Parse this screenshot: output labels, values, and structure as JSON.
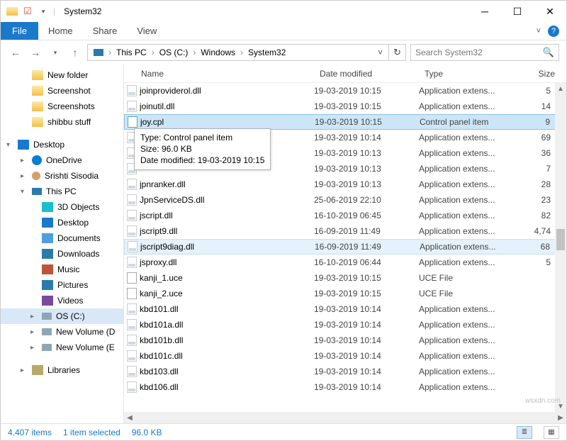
{
  "titlebar": {
    "title": "System32"
  },
  "ribbon": {
    "file": "File",
    "tabs": [
      "Home",
      "Share",
      "View"
    ]
  },
  "nav": {
    "crumbs": [
      "This PC",
      "OS (C:)",
      "Windows",
      "System32"
    ],
    "search_placeholder": "Search System32"
  },
  "tree": {
    "quick": [
      {
        "label": "New folder",
        "ico": "t-folder"
      },
      {
        "label": "Screenshot",
        "ico": "t-folder"
      },
      {
        "label": "Screenshots",
        "ico": "t-folder"
      },
      {
        "label": "shibbu stuff",
        "ico": "t-folder"
      }
    ],
    "roots": [
      {
        "label": "Desktop",
        "ico": "t-desktop",
        "chev": "▾",
        "depth": 0
      },
      {
        "label": "OneDrive",
        "ico": "t-onedrive",
        "chev": "▸",
        "depth": 1
      },
      {
        "label": "Srishti Sisodia",
        "ico": "t-user",
        "chev": "▸",
        "depth": 1
      },
      {
        "label": "This PC",
        "ico": "t-pc",
        "chev": "▾",
        "depth": 1
      },
      {
        "label": "3D Objects",
        "ico": "t-3d",
        "chev": "",
        "depth": 2
      },
      {
        "label": "Desktop",
        "ico": "t-desktop",
        "chev": "",
        "depth": 2
      },
      {
        "label": "Documents",
        "ico": "t-doc",
        "chev": "",
        "depth": 2
      },
      {
        "label": "Downloads",
        "ico": "t-dl",
        "chev": "",
        "depth": 2
      },
      {
        "label": "Music",
        "ico": "t-music",
        "chev": "",
        "depth": 2
      },
      {
        "label": "Pictures",
        "ico": "t-pic",
        "chev": "",
        "depth": 2
      },
      {
        "label": "Videos",
        "ico": "t-vid",
        "chev": "",
        "depth": 2
      },
      {
        "label": "OS (C:)",
        "ico": "t-disk",
        "chev": "▸",
        "depth": 2,
        "sel": true
      },
      {
        "label": "New Volume (D",
        "ico": "t-disk",
        "chev": "▸",
        "depth": 2
      },
      {
        "label": "New Volume (E",
        "ico": "t-disk",
        "chev": "▸",
        "depth": 2
      }
    ],
    "libraries": {
      "label": "Libraries",
      "ico": "t-lib",
      "chev": "▸"
    }
  },
  "columns": {
    "name": "Name",
    "date": "Date modified",
    "type": "Type",
    "size": "Size"
  },
  "files": [
    {
      "name": "joinproviderol.dll",
      "date": "19-03-2019 10:15",
      "type": "Application extens...",
      "size": "5",
      "ico": "dll"
    },
    {
      "name": "joinutil.dll",
      "date": "19-03-2019 10:15",
      "type": "Application extens...",
      "size": "14",
      "ico": "dll"
    },
    {
      "name": "joy.cpl",
      "date": "19-03-2019 10:15",
      "type": "Control panel item",
      "size": "9",
      "ico": "cpl",
      "sel": true
    },
    {
      "name": "",
      "date": "19-03-2019 10:14",
      "type": "Application extens...",
      "size": "69",
      "ico": "dll"
    },
    {
      "name": "",
      "date": "19-03-2019 10:13",
      "type": "Application extens...",
      "size": "36",
      "ico": "dll"
    },
    {
      "name": "",
      "date": "19-03-2019 10:13",
      "type": "Application extens...",
      "size": "7",
      "ico": "dll"
    },
    {
      "name": "jpnranker.dll",
      "date": "19-03-2019 10:13",
      "type": "Application extens...",
      "size": "28",
      "ico": "dll"
    },
    {
      "name": "JpnServiceDS.dll",
      "date": "25-06-2019 22:10",
      "type": "Application extens...",
      "size": "23",
      "ico": "dll"
    },
    {
      "name": "jscript.dll",
      "date": "16-10-2019 06:45",
      "type": "Application extens...",
      "size": "82",
      "ico": "dll"
    },
    {
      "name": "jscript9.dll",
      "date": "16-09-2019 11:49",
      "type": "Application extens...",
      "size": "4,74",
      "ico": "dll"
    },
    {
      "name": "jscript9diag.dll",
      "date": "16-09-2019 11:49",
      "type": "Application extens...",
      "size": "68",
      "ico": "dll",
      "hov": true
    },
    {
      "name": "jsproxy.dll",
      "date": "16-10-2019 06:44",
      "type": "Application extens...",
      "size": "5",
      "ico": "dll"
    },
    {
      "name": "kanji_1.uce",
      "date": "19-03-2019 10:15",
      "type": "UCE File",
      "size": "",
      "ico": "uce"
    },
    {
      "name": "kanji_2.uce",
      "date": "19-03-2019 10:15",
      "type": "UCE File",
      "size": "",
      "ico": "uce"
    },
    {
      "name": "kbd101.dll",
      "date": "19-03-2019 10:14",
      "type": "Application extens...",
      "size": "",
      "ico": "dll"
    },
    {
      "name": "kbd101a.dll",
      "date": "19-03-2019 10:14",
      "type": "Application extens...",
      "size": "",
      "ico": "dll"
    },
    {
      "name": "kbd101b.dll",
      "date": "19-03-2019 10:14",
      "type": "Application extens...",
      "size": "",
      "ico": "dll"
    },
    {
      "name": "kbd101c.dll",
      "date": "19-03-2019 10:14",
      "type": "Application extens...",
      "size": "",
      "ico": "dll"
    },
    {
      "name": "kbd103.dll",
      "date": "19-03-2019 10:14",
      "type": "Application extens...",
      "size": "",
      "ico": "dll"
    },
    {
      "name": "kbd106.dll",
      "date": "19-03-2019 10:14",
      "type": "Application extens...",
      "size": "",
      "ico": "dll"
    }
  ],
  "tooltip": {
    "l1": "Type: Control panel item",
    "l2": "Size: 96.0 KB",
    "l3": "Date modified: 19-03-2019 10:15"
  },
  "status": {
    "items": "4,407 items",
    "selected": "1 item selected",
    "size": "96.0 KB"
  },
  "watermark": "wsxdn.com"
}
